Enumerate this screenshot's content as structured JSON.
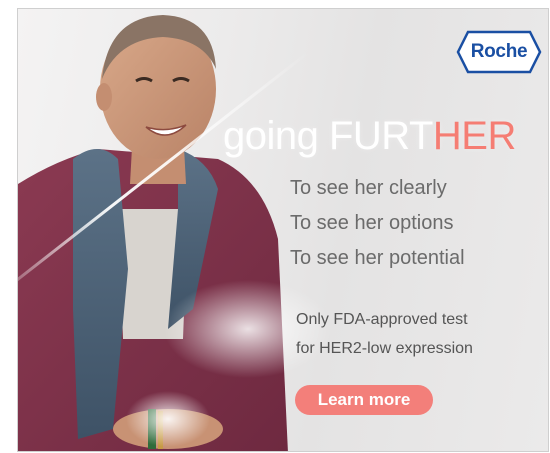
{
  "brand": {
    "logo_text": "Roche"
  },
  "headline": {
    "part1": "going FURT",
    "part2": "HER"
  },
  "taglines": [
    "To see her clearly",
    "To see her options",
    "To see her potential"
  ],
  "claim": {
    "line1": "Only FDA-approved test",
    "line2": "for HER2-low expression"
  },
  "cta": {
    "label": "Learn more"
  },
  "colors": {
    "accent": "#f37f7a",
    "brand_blue": "#1a4fa3",
    "text_gray": "#6b6b6b"
  }
}
